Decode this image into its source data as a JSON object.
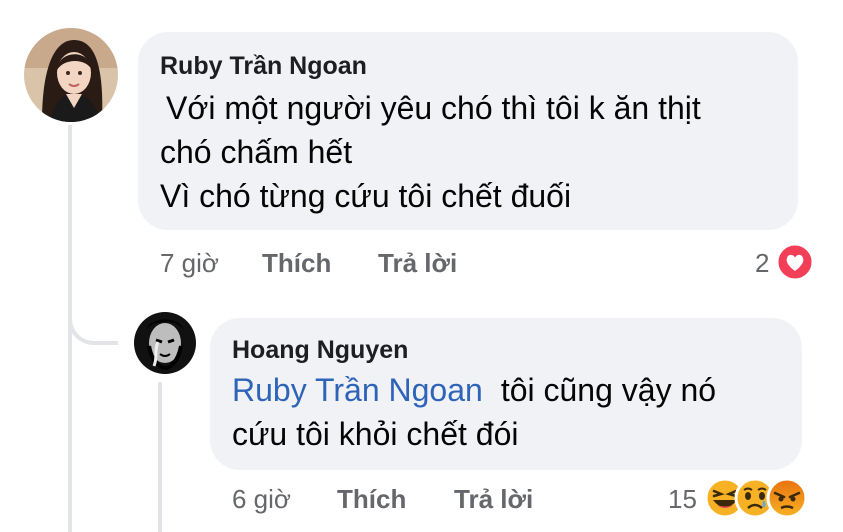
{
  "comment": {
    "author": "Ruby Trần Ngoan",
    "lines": [
      "Với một người yêu chó thì tôi k ăn thịt",
      "chó chấm hết",
      "Vì chó từng cứu tôi chết đuối"
    ],
    "time": "7 giờ",
    "like_label": "Thích",
    "reply_label": "Trả lời",
    "reaction_count": "2",
    "reactions": [
      "heart-icon"
    ]
  },
  "reply": {
    "author": "Hoang Nguyen",
    "mention": "Ruby Trần Ngoan",
    "text_after_mention": "tôi cũng vậy nó",
    "line2": "cứu tôi khỏi chết đói",
    "time": "6 giờ",
    "like_label": "Thích",
    "reply_label": "Trả lời",
    "reaction_count": "15",
    "reactions": [
      "laughing-emoji-icon",
      "sad-emoji-icon",
      "angry-emoji-icon"
    ]
  },
  "colors": {
    "bubble": "#f0f2f5",
    "mention": "#2e64b8",
    "meta": "#65676b",
    "heart": "#f33e58",
    "laugh": "#f7b125",
    "angry": "#e9710f"
  }
}
